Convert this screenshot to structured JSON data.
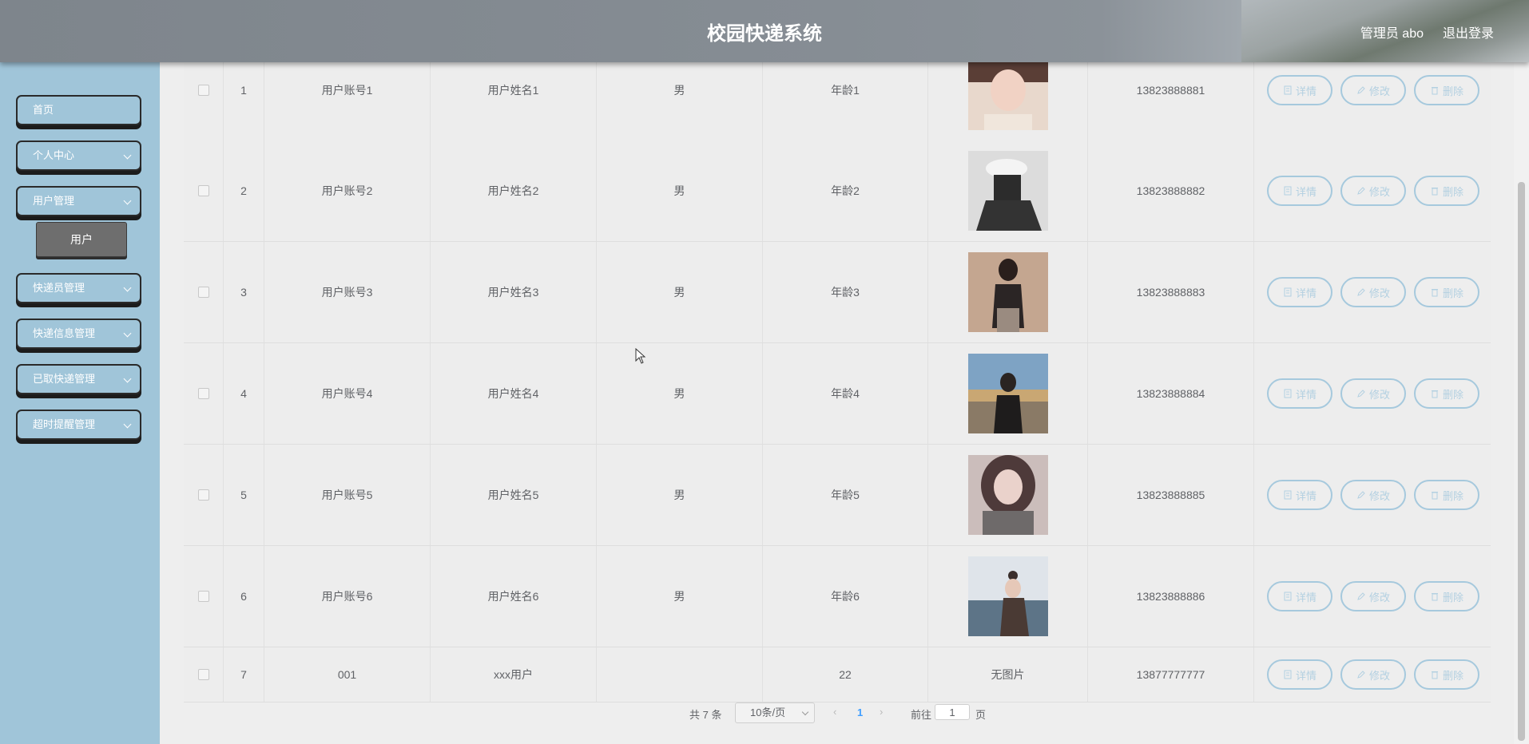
{
  "header": {
    "title": "校园快递系统",
    "admin": "管理员 abo",
    "logout": "退出登录"
  },
  "sidebar": {
    "items": [
      {
        "label": "首页"
      },
      {
        "label": "个人中心"
      },
      {
        "label": "用户管理"
      },
      {
        "label": "快递员管理"
      },
      {
        "label": "快递信息管理"
      },
      {
        "label": "已取快递管理"
      },
      {
        "label": "超时提醒管理"
      }
    ],
    "submenu_label": "用户"
  },
  "table": {
    "actions": {
      "detail": "详情",
      "edit": "修改",
      "delete": "删除"
    },
    "rows": [
      {
        "index": "1",
        "account": "用户账号1",
        "name": "用户姓名1",
        "gender": "男",
        "age": "年龄1",
        "phone": "13823888881"
      },
      {
        "index": "2",
        "account": "用户账号2",
        "name": "用户姓名2",
        "gender": "男",
        "age": "年龄2",
        "phone": "13823888882"
      },
      {
        "index": "3",
        "account": "用户账号3",
        "name": "用户姓名3",
        "gender": "男",
        "age": "年龄3",
        "phone": "13823888883"
      },
      {
        "index": "4",
        "account": "用户账号4",
        "name": "用户姓名4",
        "gender": "男",
        "age": "年龄4",
        "phone": "13823888884"
      },
      {
        "index": "5",
        "account": "用户账号5",
        "name": "用户姓名5",
        "gender": "男",
        "age": "年龄5",
        "phone": "13823888885"
      },
      {
        "index": "6",
        "account": "用户账号6",
        "name": "用户姓名6",
        "gender": "男",
        "age": "年龄6",
        "phone": "13823888886"
      },
      {
        "index": "7",
        "account": "001",
        "name": "xxx用户",
        "gender": "",
        "age": "22",
        "phone": "13877777777",
        "photo_text": "无图片"
      }
    ]
  },
  "pagination": {
    "total_text": "共 7 条",
    "page_size": "10条/页",
    "current_page": "1",
    "goto_label": "前往",
    "goto_value": "1",
    "page_suffix": "页"
  }
}
